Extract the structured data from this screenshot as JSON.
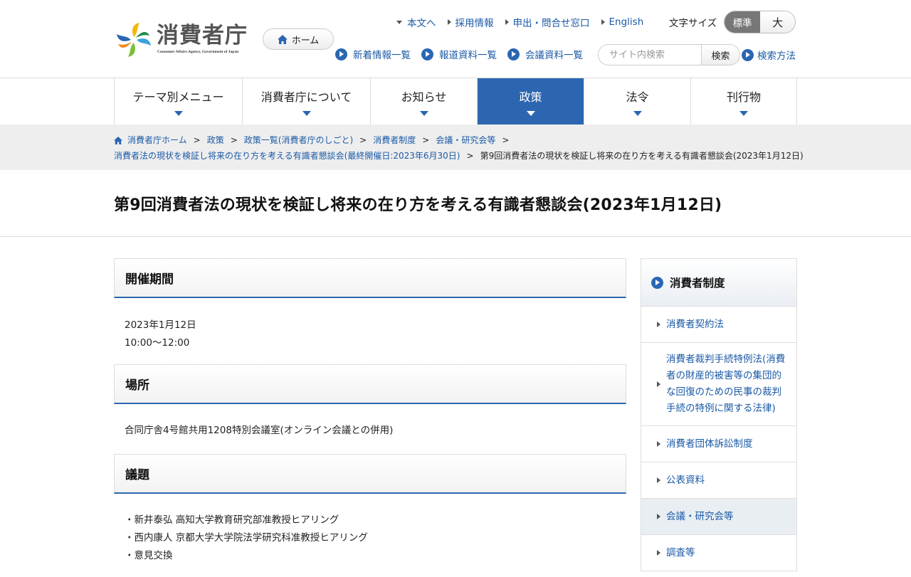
{
  "header": {
    "logo_text": "消費者庁",
    "logo_sub": "Consumer Affairs Agency, Government of Japan",
    "home_label": "ホーム",
    "util_links": [
      "本文へ",
      "採用情報",
      "申出・問合せ窓口",
      "English"
    ],
    "font_size_label": "文字サイズ",
    "font_size_standard": "標準",
    "font_size_large": "大",
    "quick_links": [
      "新着情報一覧",
      "報道資料一覧",
      "会議資料一覧"
    ],
    "search_placeholder": "サイト内検索",
    "search_button": "検索",
    "search_method": "検索方法"
  },
  "gnav": [
    "テーマ別メニュー",
    "消費者庁について",
    "お知らせ",
    "政策",
    "法令",
    "刊行物"
  ],
  "gnav_active": "政策",
  "breadcrumb": {
    "line1": [
      "消費者庁ホーム",
      "政策",
      "政策一覧(消費者庁のしごと)",
      "消費者制度",
      "会議・研究会等"
    ],
    "line2_link": "消費者法の現状を検証し将来の在り方を考える有識者懇談会(最終開催日:2023年6月30日)",
    "current": "第9回消費者法の現状を検証し将来の在り方を考える有識者懇談会(2023年1月12日)"
  },
  "page_title": "第9回消費者法の現状を検証し将来の在り方を考える有識者懇談会(2023年1月12日)",
  "sections": {
    "period": {
      "heading": "開催期間",
      "date": "2023年1月12日",
      "time": "10:00～12:00"
    },
    "place": {
      "heading": "場所",
      "text": "合同庁舎4号館共用1208特別会議室(オンライン会議との併用)"
    },
    "agenda": {
      "heading": "議題",
      "items": [
        "・新井泰弘 高知大学教育研究部准教授ヒアリング",
        "・西内康人 京都大学大学院法学研究科准教授ヒアリング",
        "・意見交換"
      ]
    }
  },
  "sidebar": {
    "heading": "消費者制度",
    "items": [
      "消費者契約法",
      "消費者裁判手続特例法(消費者の財産的被害等の集団的な回復のための民事の裁判手続の特例に関する法律)",
      "消費者団体訴訟制度",
      "公表資料",
      "会議・研究会等",
      "調査等"
    ],
    "active": "会議・研究会等"
  },
  "colors": {
    "accent": "#2d66b0",
    "link": "#1b5aa6",
    "breadcrumb_bg": "#eeeeee"
  }
}
